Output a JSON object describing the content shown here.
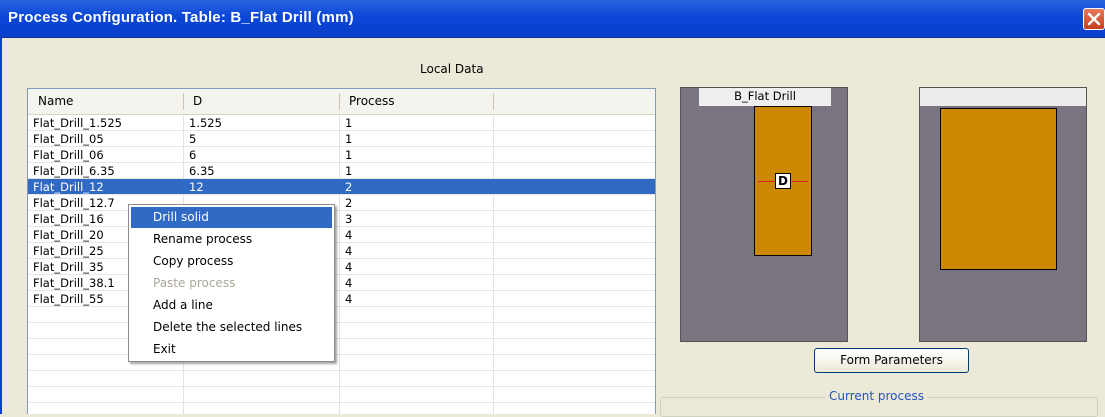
{
  "window": {
    "title": "Process Configuration. Table: B_Flat Drill (mm)"
  },
  "section_title": "Local Data",
  "table": {
    "columns": [
      "Name",
      "D",
      "Process"
    ],
    "rows": [
      {
        "name": "Flat_Drill_1.525",
        "d": "1.525",
        "process": "1"
      },
      {
        "name": "Flat_Drill_05",
        "d": "5",
        "process": "1"
      },
      {
        "name": "Flat_Drill_06",
        "d": "6",
        "process": "1"
      },
      {
        "name": "Flat_Drill_6.35",
        "d": "6.35",
        "process": "1"
      },
      {
        "name": "Flat_Drill_12",
        "d": "12",
        "process": "2"
      },
      {
        "name": "Flat_Drill_12.7",
        "d": "",
        "process": "2"
      },
      {
        "name": "Flat_Drill_16",
        "d": "",
        "process": "3"
      },
      {
        "name": "Flat_Drill_20",
        "d": "",
        "process": "4"
      },
      {
        "name": "Flat_Drill_25",
        "d": "",
        "process": "4"
      },
      {
        "name": "Flat_Drill_35",
        "d": "",
        "process": "4"
      },
      {
        "name": "Flat_Drill_38.1",
        "d": "",
        "process": "4"
      },
      {
        "name": "Flat_Drill_55",
        "d": "",
        "process": "4"
      }
    ],
    "selected_row": 4
  },
  "context_menu": {
    "items": [
      {
        "label": "Drill solid",
        "state": "highlighted"
      },
      {
        "label": "Rename process",
        "state": "normal"
      },
      {
        "label": "Copy process",
        "state": "normal"
      },
      {
        "label": "Paste process",
        "state": "disabled"
      },
      {
        "label": "Add a line",
        "state": "normal"
      },
      {
        "label": "Delete the selected lines",
        "state": "normal"
      },
      {
        "label": "Exit",
        "state": "normal"
      }
    ]
  },
  "preview": {
    "front_label": "B_Flat Drill",
    "dimension_label": "D",
    "side_label": ""
  },
  "buttons": {
    "form_parameters": "Form Parameters"
  },
  "current_process": {
    "label": "Current process"
  },
  "colors": {
    "title_bar": "#0a46d8",
    "selection": "#316ac5",
    "drill": "#cc8800",
    "preview_bg": "#7a7480",
    "group_label": "#2152c4"
  }
}
